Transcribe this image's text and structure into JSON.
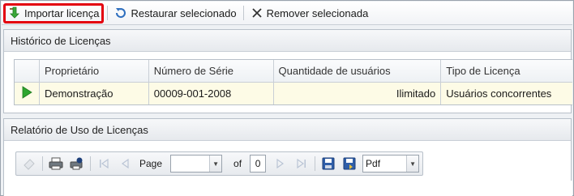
{
  "toolbar": {
    "import_label": "Importar licença",
    "restore_label": "Restaurar selecionado",
    "remove_label": "Remover selecionada"
  },
  "history_panel": {
    "title": "Histórico de Licenças",
    "columns": [
      "Proprietário",
      "Número de Série",
      "Quantidade de usuários",
      "Tipo de Licença"
    ],
    "rows": [
      {
        "owner": "Demonstração",
        "serial": "00009-001-2008",
        "users": "Ilimitado",
        "type": "Usuários concorrentes"
      }
    ]
  },
  "report_panel": {
    "title": "Relatório de Uso de Licenças",
    "page_label": "Page",
    "page_value": "",
    "of_label": "of",
    "total_pages": "0",
    "export_format": "Pdf"
  },
  "colors": {
    "highlight_border": "#e3000f",
    "selected_row_bg": "#fdfbe6",
    "play_green": "#2ea52e"
  }
}
